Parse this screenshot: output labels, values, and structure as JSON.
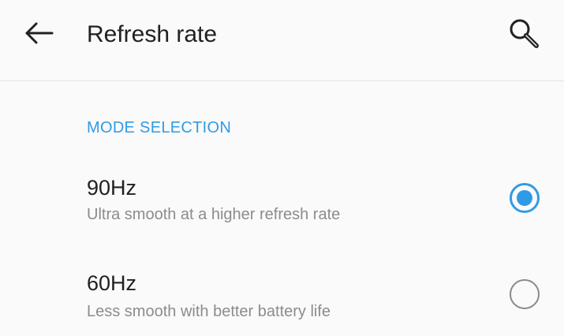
{
  "header": {
    "title": "Refresh rate",
    "back_icon": "arrow-left-icon",
    "search_icon": "search-icon"
  },
  "section": {
    "title": "MODE SELECTION"
  },
  "options": [
    {
      "title": "90Hz",
      "subtitle": "Ultra smooth at a higher refresh rate",
      "selected": true
    },
    {
      "title": "60Hz",
      "subtitle": "Less smooth with better battery life",
      "selected": false
    }
  ],
  "colors": {
    "accent": "#2f9be6",
    "text_primary": "#212121",
    "text_secondary": "#8c8c8c",
    "background": "#fafafa"
  }
}
